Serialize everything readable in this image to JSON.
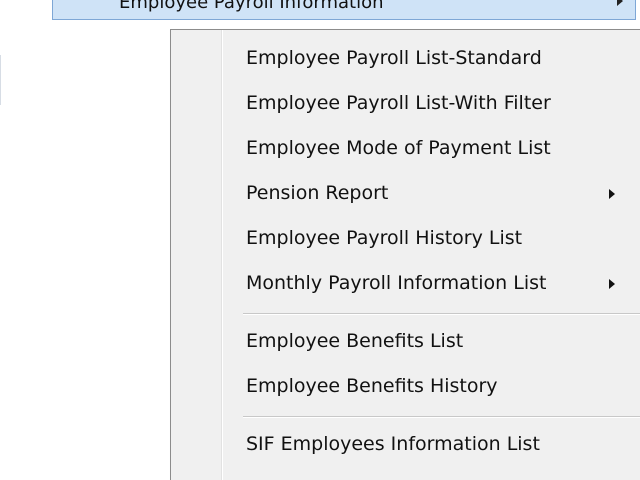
{
  "parent_menu": {
    "label": "Employee Payroll Information"
  },
  "submenu": {
    "items": [
      {
        "label": "Employee Payroll List-Standard",
        "has_submenu": false
      },
      {
        "label": "Employee Payroll List-With Filter",
        "has_submenu": false
      },
      {
        "label": "Employee Mode of Payment List",
        "has_submenu": false
      },
      {
        "label": "Pension Report",
        "has_submenu": true
      },
      {
        "label": "Employee Payroll History List",
        "has_submenu": false
      },
      {
        "label": "Monthly Payroll Information List",
        "has_submenu": true
      },
      {
        "label": "Employee Benefits List",
        "has_submenu": false
      },
      {
        "label": "Employee Benefits History",
        "has_submenu": false
      },
      {
        "label": "SIF Employees Information List",
        "has_submenu": false
      }
    ]
  },
  "colors": {
    "highlight_bg": "#cfe3f7",
    "highlight_border": "#7ea7d6",
    "menu_bg": "#f0f0f0",
    "text": "#111111"
  }
}
